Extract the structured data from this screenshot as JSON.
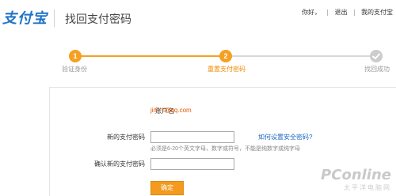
{
  "header": {
    "logo_text": "支付宝",
    "title": "找回支付密码",
    "nav": {
      "greeting": "你好，",
      "logout": "退出",
      "my_alipay": "我的支付宝"
    }
  },
  "steps": [
    {
      "number": "1",
      "label": "验证身份",
      "state": "done"
    },
    {
      "number": "2",
      "label": "重置支付密码",
      "state": "current"
    },
    {
      "number": "",
      "label": "找回成功",
      "state": "todo"
    }
  ],
  "form": {
    "account_label": "账户名",
    "account_value": "jin***@qq.com",
    "new_password_label": "新的支付密码",
    "new_password_value": "",
    "help_link": "如何设置安全密码?",
    "hint": "必须是6-20个英文字母，数字或符号，不能是纯数字或纯字母",
    "confirm_password_label": "确认新的支付密码",
    "confirm_password_value": "",
    "submit_label": "确定"
  },
  "watermark": {
    "main": "PConline",
    "sub": "太平洋电脑网"
  },
  "colors": {
    "brand_blue": "#1f73c8",
    "accent_orange": "#f5a020",
    "link_blue": "#1a66c2",
    "account_orange": "#e05a00"
  },
  "icons": {
    "step3": "checkmark-icon"
  }
}
